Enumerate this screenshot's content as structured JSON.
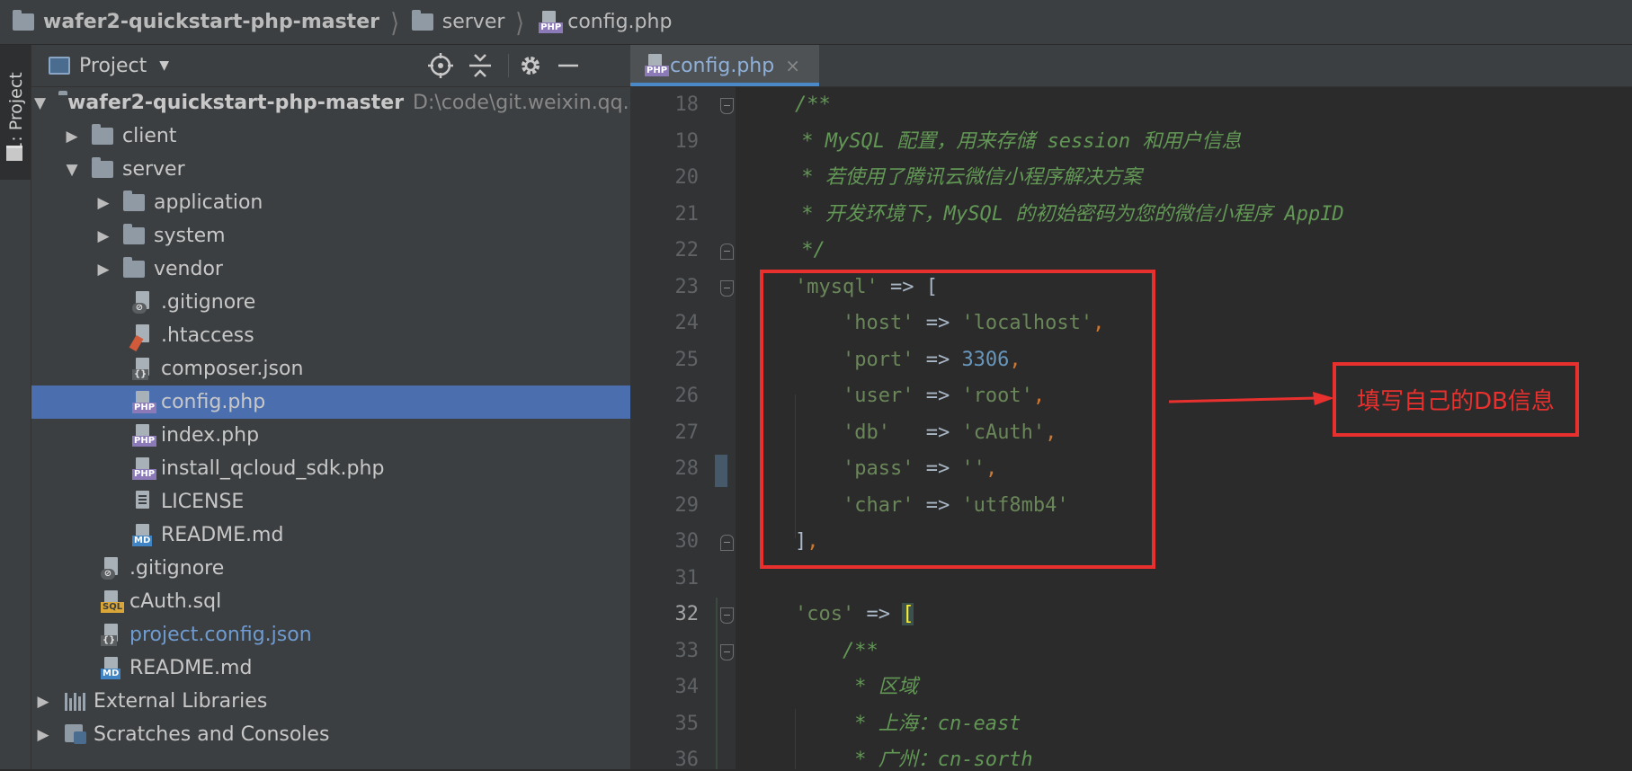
{
  "breadcrumb": {
    "project": "wafer2-quickstart-php-master",
    "folder": "server",
    "file": "config.php"
  },
  "tool_window": {
    "tab_label": "1: Project"
  },
  "project_panel": {
    "title": "Project",
    "tree": [
      {
        "label": "wafer2-quickstart-php-master",
        "hint": "D:\\code\\git.weixin.qq.c",
        "type": "root-folder",
        "expanded": true
      },
      {
        "label": "client",
        "type": "folder",
        "expanded": false
      },
      {
        "label": "server",
        "type": "folder",
        "expanded": true
      },
      {
        "label": "application",
        "type": "folder",
        "expanded": false
      },
      {
        "label": "system",
        "type": "folder",
        "expanded": false
      },
      {
        "label": "vendor",
        "type": "folder",
        "expanded": false
      },
      {
        "label": ".gitignore",
        "type": "ignore-file"
      },
      {
        "label": ".htaccess",
        "type": "htaccess-file"
      },
      {
        "label": "composer.json",
        "type": "json-file"
      },
      {
        "label": "config.php",
        "type": "php-file",
        "selected": true
      },
      {
        "label": "index.php",
        "type": "php-file"
      },
      {
        "label": "install_qcloud_sdk.php",
        "type": "php-file"
      },
      {
        "label": "LICENSE",
        "type": "text-file"
      },
      {
        "label": "README.md",
        "type": "md-file"
      },
      {
        "label": ".gitignore",
        "type": "ignore-file"
      },
      {
        "label": "cAuth.sql",
        "type": "sql-file"
      },
      {
        "label": "project.config.json",
        "type": "json-file",
        "highlighted": true
      },
      {
        "label": "README.md",
        "type": "md-file"
      },
      {
        "label": "External Libraries",
        "type": "libraries"
      },
      {
        "label": "Scratches and Consoles",
        "type": "scratches"
      }
    ]
  },
  "editor": {
    "tab_label": "config.php",
    "current_line": 32,
    "lines": [
      {
        "n": "18",
        "parts": [
          {
            "t": "/**",
            "c": "cm"
          }
        ]
      },
      {
        "n": "19",
        "parts": [
          {
            "t": " * MySQL 配置，用来存储 session 和用户信息",
            "c": "cm"
          }
        ]
      },
      {
        "n": "20",
        "parts": [
          {
            "t": " * 若使用了腾讯云微信小程序解决方案",
            "c": "cm"
          }
        ]
      },
      {
        "n": "21",
        "parts": [
          {
            "t": " * 开发环境下，MySQL 的初始密码为您的微信小程序 AppID",
            "c": "cm"
          }
        ]
      },
      {
        "n": "22",
        "parts": [
          {
            "t": " */",
            "c": "cm"
          }
        ]
      },
      {
        "n": "23",
        "parts": [
          {
            "t": "'mysql'",
            "c": "str"
          },
          {
            "t": " => [",
            "c": "op"
          }
        ]
      },
      {
        "n": "24",
        "parts": [
          {
            "t": "    'host'",
            "c": "str"
          },
          {
            "t": " => ",
            "c": "op"
          },
          {
            "t": "'localhost'",
            "c": "str"
          },
          {
            "t": ",",
            "c": "cmm"
          }
        ]
      },
      {
        "n": "25",
        "parts": [
          {
            "t": "    'port'",
            "c": "str"
          },
          {
            "t": " => ",
            "c": "op"
          },
          {
            "t": "3306",
            "c": "num"
          },
          {
            "t": ",",
            "c": "cmm"
          }
        ]
      },
      {
        "n": "26",
        "parts": [
          {
            "t": "    'user'",
            "c": "str"
          },
          {
            "t": " => ",
            "c": "op"
          },
          {
            "t": "'root'",
            "c": "str"
          },
          {
            "t": ",",
            "c": "cmm"
          }
        ]
      },
      {
        "n": "27",
        "parts": [
          {
            "t": "    'db'",
            "c": "str"
          },
          {
            "t": "   => ",
            "c": "op"
          },
          {
            "t": "'cAuth'",
            "c": "str"
          },
          {
            "t": ",",
            "c": "cmm"
          }
        ]
      },
      {
        "n": "28",
        "parts": [
          {
            "t": "    'pass'",
            "c": "str"
          },
          {
            "t": " => ",
            "c": "op"
          },
          {
            "t": "''",
            "c": "str"
          },
          {
            "t": ",",
            "c": "cmm"
          }
        ]
      },
      {
        "n": "29",
        "parts": [
          {
            "t": "    'char'",
            "c": "str"
          },
          {
            "t": " => ",
            "c": "op"
          },
          {
            "t": "'utf8mb4'",
            "c": "str"
          }
        ]
      },
      {
        "n": "30",
        "parts": [
          {
            "t": "]",
            "c": "op"
          },
          {
            "t": ",",
            "c": "cmm"
          }
        ]
      },
      {
        "n": "31",
        "parts": []
      },
      {
        "n": "32",
        "parts": [
          {
            "t": "'cos'",
            "c": "str"
          },
          {
            "t": " => ",
            "c": "op"
          },
          {
            "t": "[",
            "c": "bracket-hl"
          }
        ]
      },
      {
        "n": "33",
        "parts": [
          {
            "t": "    /**",
            "c": "cm"
          }
        ]
      },
      {
        "n": "34",
        "parts": [
          {
            "t": "     * 区域",
            "c": "cm"
          }
        ]
      },
      {
        "n": "35",
        "parts": [
          {
            "t": "     * 上海：cn-east",
            "c": "cm"
          }
        ]
      },
      {
        "n": "36",
        "parts": [
          {
            "t": "     * 广州：cn-sorth",
            "c": "cm"
          }
        ]
      }
    ]
  },
  "annotation": {
    "callout_text": "填写自己的DB信息",
    "color": "#e8302e"
  },
  "colors": {
    "background": "#2b2b2b",
    "panel": "#3c3f41",
    "selection": "#4b6eaf",
    "comment": "#629755",
    "string": "#6a8759",
    "number": "#6897bb"
  }
}
